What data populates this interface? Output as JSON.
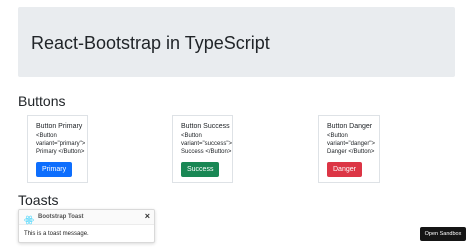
{
  "header": {
    "title": "React-Bootstrap in TypeScript"
  },
  "buttons_section": {
    "title": "Buttons",
    "cards": [
      {
        "title": "Button Primary",
        "code": "<Button\nvariant=\"primary\">\nPrimary </Button>",
        "button_label": "Primary",
        "color": "#0d6efd"
      },
      {
        "title": "Button Success",
        "code": "<Button\nvariant=\"success\">\nSuccess </Button>",
        "button_label": "Success",
        "color": "#198754"
      },
      {
        "title": "Button Danger",
        "code": "<Button\nvariant=\"danger\">\nDanger </Button>",
        "button_label": "Danger",
        "color": "#dc3545"
      }
    ]
  },
  "toasts_section": {
    "title": "Toasts",
    "toast": {
      "title": "Bootstrap Toast",
      "close_label": "×",
      "message": "This is a toast message.",
      "icon": "react-logo-icon"
    }
  },
  "footer": {
    "open_sandbox_label": "Open Sandbox"
  }
}
